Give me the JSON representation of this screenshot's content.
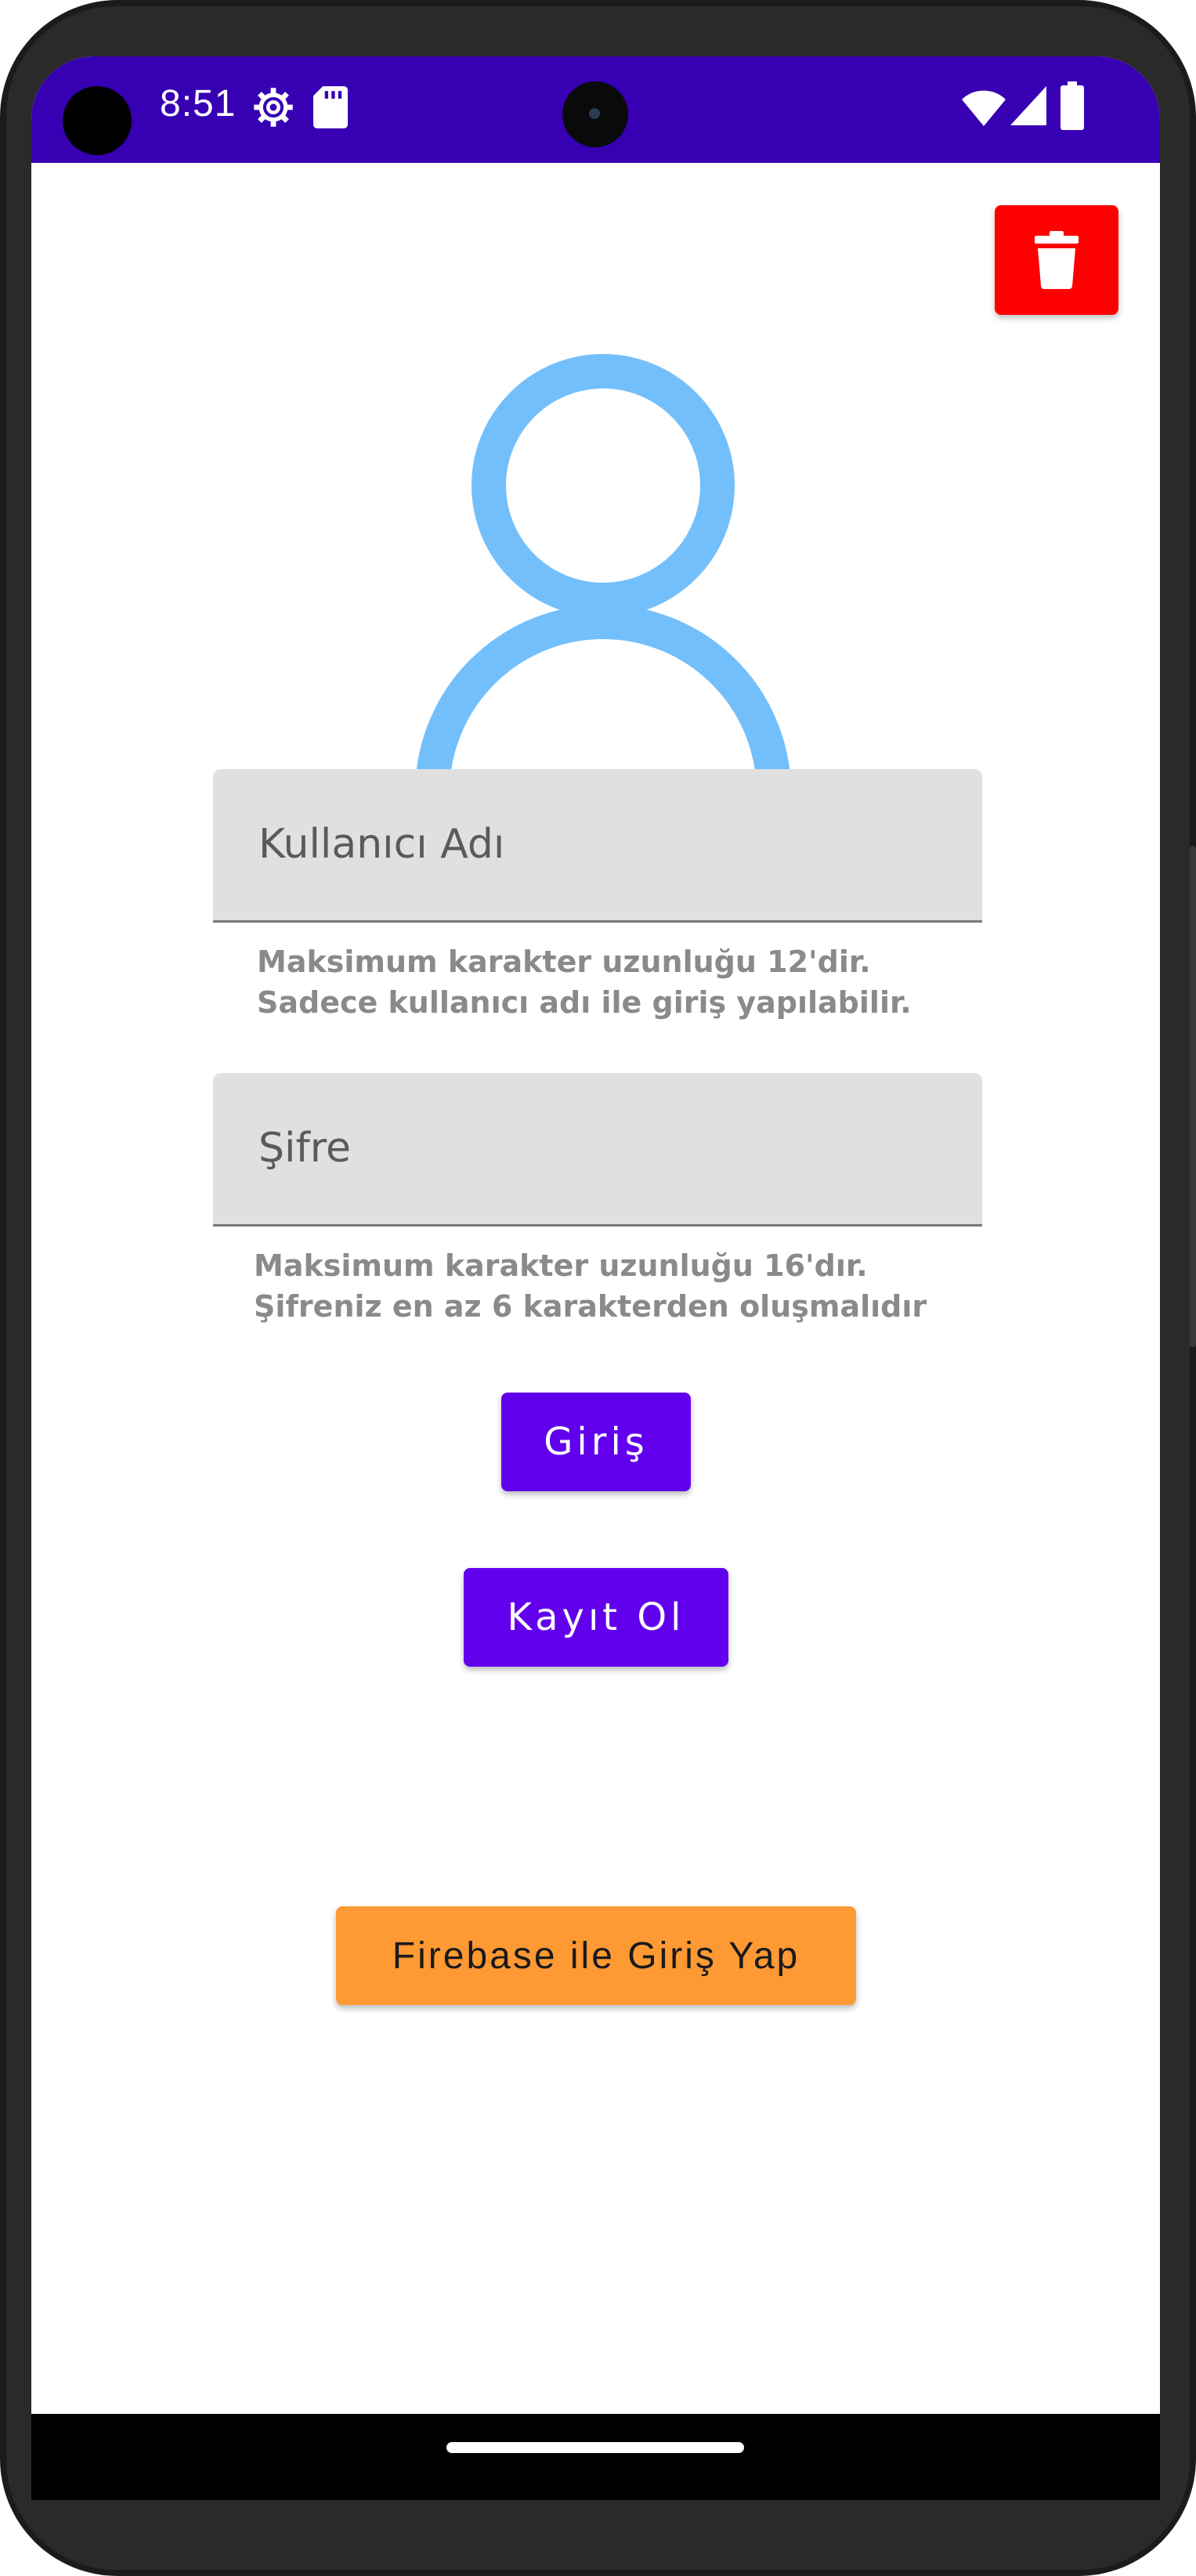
{
  "status_bar": {
    "time": "8:51",
    "left_icons": [
      "settings-icon",
      "sd-card-icon"
    ],
    "right_icons": [
      "wifi-icon",
      "cell-signal-icon",
      "battery-icon"
    ],
    "background_color": "#3700b3"
  },
  "toolbar": {
    "delete_icon": "trash-icon",
    "delete_color": "#ff0000"
  },
  "avatar": {
    "icon": "person-icon",
    "color": "#73bffb"
  },
  "form": {
    "username": {
      "placeholder": "Kullanıcı Adı",
      "value": "",
      "helper_line1": "Maksimum karakter uzunluğu 12'dir.",
      "helper_line2": "Sadece kullanıcı adı ile giriş yapılabilir."
    },
    "password": {
      "placeholder": "Şifre",
      "value": "",
      "helper_line1": "Maksimum karakter uzunluğu 16'dır.",
      "helper_line2": "Şifreniz en az 6 karakterden oluşmalıdır"
    }
  },
  "actions": {
    "login_label": "Giriş",
    "register_label": "Kayıt Ol",
    "firebase_label": "Firebase ile Giriş Yap",
    "primary_color": "#6200ee",
    "firebase_color": "#ff9933"
  }
}
